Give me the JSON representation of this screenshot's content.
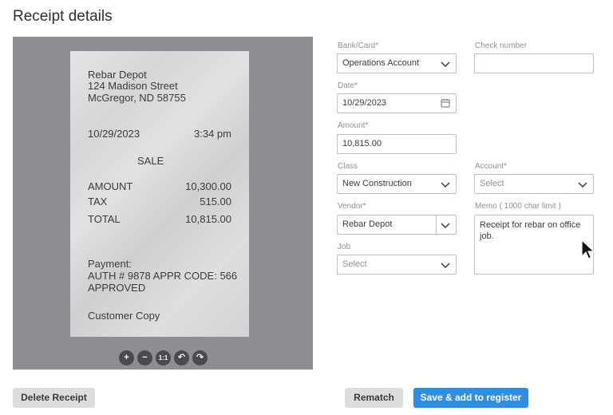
{
  "page": {
    "title": "Receipt details"
  },
  "receipt": {
    "merchant": "Rebar Depot",
    "street": "124 Madison Street",
    "city": "McGregor, ND 58755",
    "date": "10/29/2023",
    "time": "3:34 pm",
    "type": "SALE",
    "amount_label": "AMOUNT",
    "amount_value": "10,300.00",
    "tax_label": "TAX",
    "tax_value": "515.00",
    "total_label": "TOTAL",
    "total_value": "10,815.00",
    "payment_label": "Payment:",
    "auth_line": "AUTH # 9878 APPR CODE: 566",
    "approved": "APPROVED",
    "copy_label": "Customer Copy"
  },
  "viewer_tools": {
    "zoom_in": "+",
    "zoom_out": "−",
    "actual_size": "1:1",
    "rotate_left": "↶",
    "rotate_right": "↷"
  },
  "form": {
    "bank_card": {
      "label": "Bank/Card*",
      "value": "Operations Account"
    },
    "check_number": {
      "label": "Check number",
      "value": ""
    },
    "date": {
      "label": "Date*",
      "value": "10/29/2023"
    },
    "amount": {
      "label": "Amount*",
      "value": "10,815.00"
    },
    "class": {
      "label": "Class",
      "value": "New Construction"
    },
    "account": {
      "label": "Account*",
      "placeholder": "Select"
    },
    "vendor": {
      "label": "Vendor*",
      "value": "Rebar Depot"
    },
    "memo": {
      "label": "Memo ( 1000 char limit )",
      "value": "Receipt for rebar on office job."
    },
    "job": {
      "label": "Job",
      "placeholder": "Select"
    }
  },
  "actions": {
    "delete": "Delete Receipt",
    "rematch": "Rematch",
    "save": "Save & add to register"
  },
  "icons": {
    "dropdown": "chevron-down-icon",
    "calendar": "calendar-icon",
    "pointer": "mouse-pointer-icon"
  },
  "colors": {
    "primary_button": "#2f8ee0",
    "viewer_background": "#8d8d93"
  }
}
